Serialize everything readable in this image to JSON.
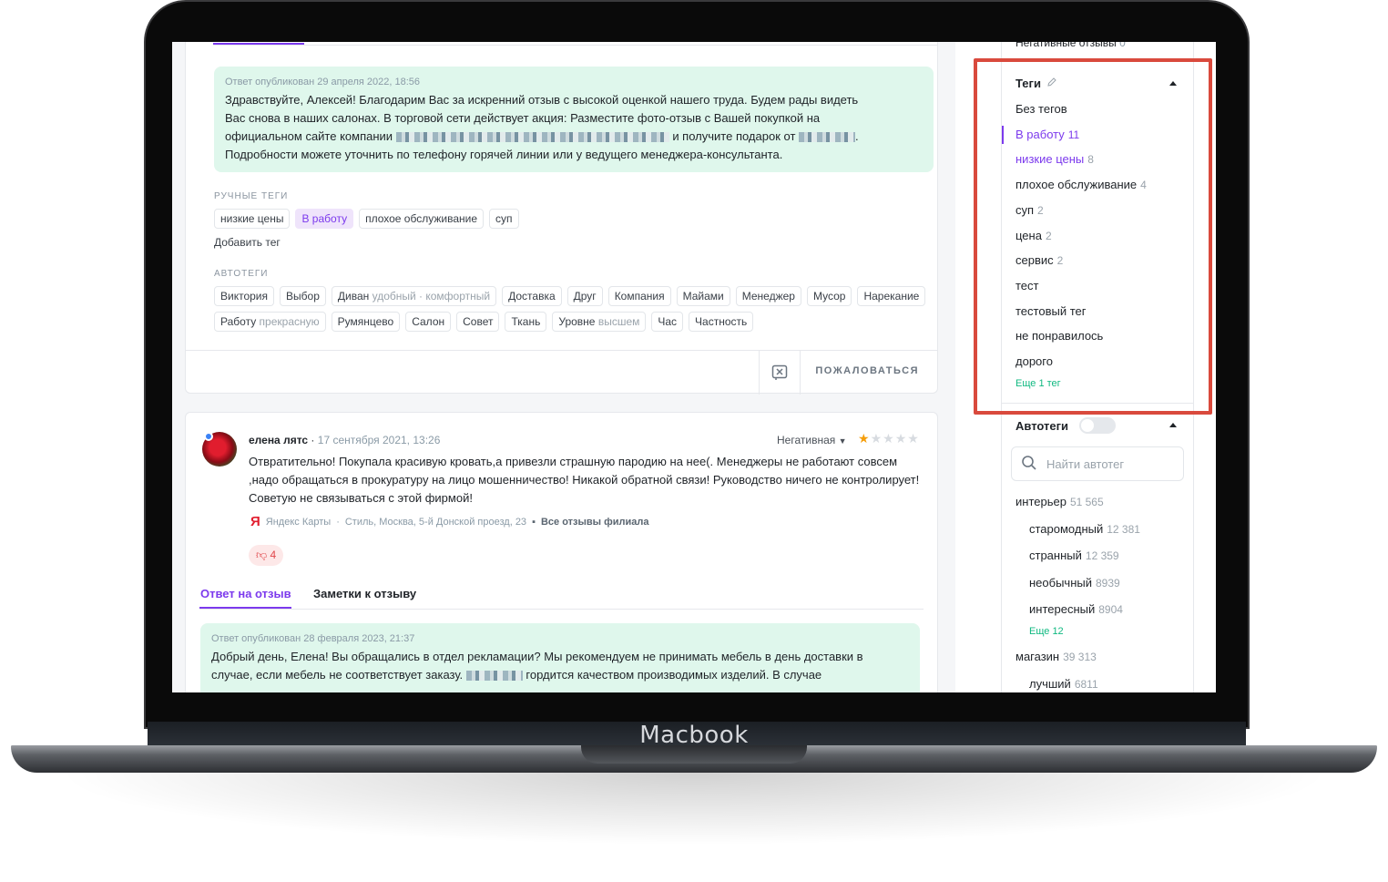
{
  "device": {
    "brand": "Macbook"
  },
  "review1": {
    "reply_meta": "Ответ опубликован 29 апреля 2022, 18:56",
    "reply_line1": "Здравствуйте, Алексей! Благодарим Вас за искренний отзыв с высокой оценкой нашего труда. Будем рады видеть",
    "reply_line2": "Вас снова в наших салонах. В торговой сети действует акция: Разместите фото-отзыв с Вашей покупкой на",
    "reply_line3a": "официальном сайте компании",
    "reply_line3b": "и получите подарок от",
    "reply_line4": "Подробности можете уточнить по телефону горячей линии или у ведущего менеджера-консультанта.",
    "manual_tags_title": "РУЧНЫЕ ТЕГИ",
    "manual_tags": [
      "низкие цены",
      "В работу",
      "плохое обслуживание",
      "суп"
    ],
    "add_tag": "Добавить тег",
    "auto_tags_title": "АВТОТЕГИ",
    "auto_tags": [
      {
        "main": "Виктория",
        "muted": ""
      },
      {
        "main": "Выбор",
        "muted": ""
      },
      {
        "main": "Диван",
        "muted": "удобный · комфортный"
      },
      {
        "main": "Доставка",
        "muted": ""
      },
      {
        "main": "Друг",
        "muted": ""
      },
      {
        "main": "Компания",
        "muted": ""
      },
      {
        "main": "Майами",
        "muted": ""
      },
      {
        "main": "Менеджер",
        "muted": ""
      },
      {
        "main": "Мусор",
        "muted": ""
      },
      {
        "main": "Нарекание",
        "muted": ""
      },
      {
        "main": "Работу",
        "muted": "прекрасную"
      },
      {
        "main": "Румянцево",
        "muted": ""
      },
      {
        "main": "Салон",
        "muted": ""
      },
      {
        "main": "Совет",
        "muted": ""
      },
      {
        "main": "Ткань",
        "muted": ""
      },
      {
        "main": "Уровне",
        "muted": "высшем"
      },
      {
        "main": "Час",
        "muted": ""
      },
      {
        "main": "Частность",
        "muted": ""
      }
    ],
    "complain": "ПОЖАЛОВАТЬСЯ"
  },
  "review2": {
    "author": "елена лятс",
    "date": "17 сентября 2021, 13:26",
    "sentiment": "Негативная",
    "rating": 1,
    "text": "Отвратительно! Покупала красивую кровать,а привезли страшную пародию на нее(. Менеджеры не работают совсем ,надо обращаться в прокуратуру на лицо мошенничество! Никакой обратной связи! Руководство ничего не контролирует! Советую не связываться с этой фирмой!",
    "source_name": "Яндекс Карты",
    "source_address": "Стиль, Москва, 5-й Донской проезд, 23",
    "all_reviews": "Все отзывы филиала",
    "dislikes": "4",
    "tab_reply": "Ответ на отзыв",
    "tab_notes": "Заметки к отзыву",
    "reply_meta": "Ответ опубликован 28 февраля 2023, 21:37",
    "reply_line1": "Добрый день, Елена! Вы обращались в отдел рекламации? Мы рекомендуем не принимать мебель в день доставки в",
    "reply_line2a": "случае, если мебель не соответствует заказу.",
    "reply_line2b": "гордится качеством производимых изделий. В случае"
  },
  "sidebar": {
    "negative_label": "Негативные отзывы",
    "negative_count": "0",
    "tags_title": "Теги",
    "tags": [
      {
        "label": "Без тегов",
        "count": ""
      },
      {
        "label": "В работу",
        "count": "11"
      },
      {
        "label": "низкие цены",
        "count": "8"
      },
      {
        "label": "плохое обслуживание",
        "count": "4"
      },
      {
        "label": "суп",
        "count": "2"
      },
      {
        "label": "цена",
        "count": "2"
      },
      {
        "label": "сервис",
        "count": "2"
      },
      {
        "label": "тест",
        "count": ""
      },
      {
        "label": "тестовый тег",
        "count": ""
      },
      {
        "label": "не понравилось",
        "count": ""
      },
      {
        "label": "дорого",
        "count": ""
      }
    ],
    "tags_more": "Еще 1 тег",
    "autotags_title": "Автотеги",
    "search_placeholder": "Найти автотег",
    "autotags": [
      {
        "label": "интерьер",
        "count": "51 565"
      },
      {
        "label": "старомодный",
        "count": "12 381"
      },
      {
        "label": "странный",
        "count": "12 359"
      },
      {
        "label": "необычный",
        "count": "8939"
      },
      {
        "label": "интересный",
        "count": "8904"
      },
      {
        "label": "магазин",
        "count": "39 313"
      },
      {
        "label": "лучший",
        "count": "6811"
      }
    ],
    "autotags_more": "Еще 12"
  },
  "colors": {
    "accent": "#7c3aed",
    "reply_bg": "#dff7ec",
    "highlight_box": "#d94a3d",
    "more_link": "#10b981"
  }
}
